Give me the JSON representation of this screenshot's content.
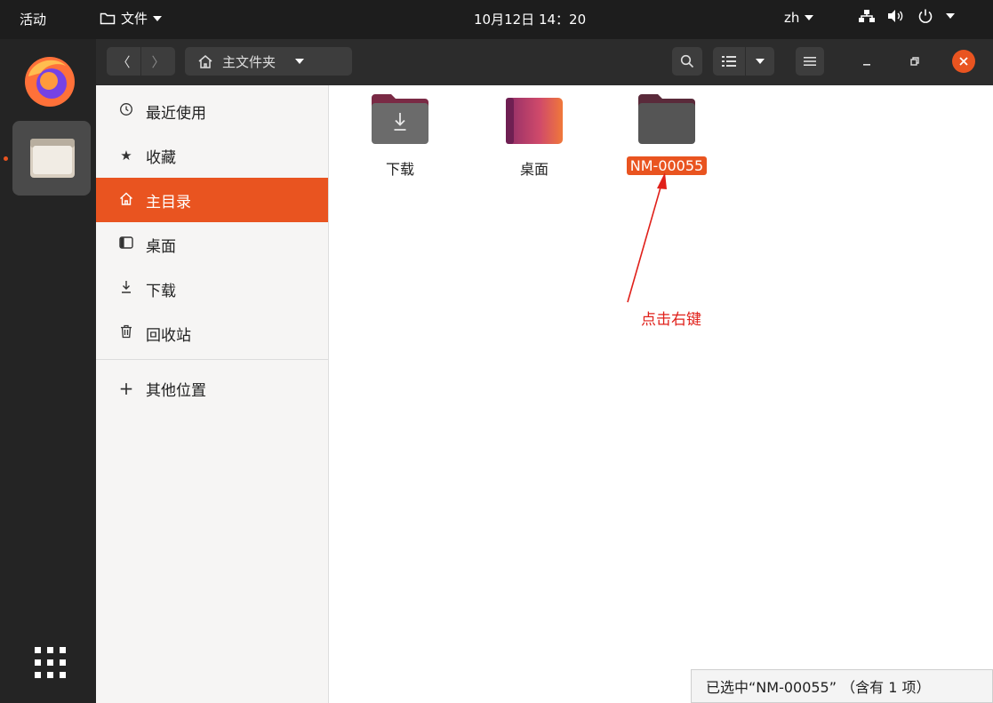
{
  "topbar": {
    "activities": "活动",
    "app_menu_label": "文件",
    "clock": "10月12日 14：20",
    "language": "zh"
  },
  "headerbar": {
    "back_glyph": "〈",
    "forward_glyph": "〉",
    "path_label": "主文件夹"
  },
  "sidebar": {
    "items": [
      {
        "label": "最近使用",
        "icon": "clock-icon"
      },
      {
        "label": "收藏",
        "icon": "star-icon"
      },
      {
        "label": "主目录",
        "icon": "home-icon",
        "active": true
      },
      {
        "label": "桌面",
        "icon": "desktop-icon"
      },
      {
        "label": "下载",
        "icon": "download-icon"
      },
      {
        "label": "回收站",
        "icon": "trash-icon"
      }
    ],
    "other_locations": "其他位置"
  },
  "content": {
    "items": [
      {
        "name": "下载",
        "icon": "folder-download-icon"
      },
      {
        "name": "桌面",
        "icon": "folder-desktop-icon"
      },
      {
        "name": "NM-00055",
        "icon": "folder-icon",
        "selected": true
      }
    ]
  },
  "annotation": {
    "text": "点击右键"
  },
  "status": {
    "text": "已选中“NM-00055” （含有 1 项）"
  },
  "colors": {
    "accent": "#e95420",
    "topbar": "#1d1d1d",
    "headerbar": "#2c2c2c",
    "annotation": "#e0201a"
  }
}
